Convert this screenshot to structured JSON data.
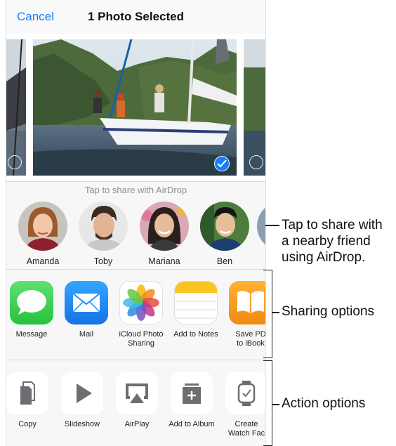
{
  "navbar": {
    "cancel_label": "Cancel",
    "title": "1 Photo Selected"
  },
  "photos": [
    {
      "name": "partial-left-photo",
      "selected": false
    },
    {
      "name": "sailboat-photo",
      "selected": true
    },
    {
      "name": "partial-right-photo",
      "selected": false
    }
  ],
  "airdrop": {
    "hint": "Tap to share with AirDrop",
    "contacts": [
      {
        "name": "Amanda"
      },
      {
        "name": "Toby"
      },
      {
        "name": "Mariana"
      },
      {
        "name": "Ben"
      }
    ]
  },
  "share_apps": [
    {
      "label": "Message",
      "icon": "message-icon"
    },
    {
      "label": "Mail",
      "icon": "mail-icon"
    },
    {
      "label_line1": "iCloud Photo",
      "label_line2": "Sharing",
      "icon": "photos-icon"
    },
    {
      "label": "Add to Notes",
      "icon": "notes-icon"
    },
    {
      "label_line1": "Save PD",
      "label_line2": "to iBook",
      "icon": "ibooks-icon"
    }
  ],
  "actions": [
    {
      "label": "Copy",
      "icon": "copy-icon"
    },
    {
      "label": "Slideshow",
      "icon": "play-icon"
    },
    {
      "label": "AirPlay",
      "icon": "airplay-icon"
    },
    {
      "label": "Add to Album",
      "icon": "add-album-icon"
    },
    {
      "label_line1": "Create",
      "label_line2": "Watch Fac",
      "icon": "watch-icon"
    }
  ],
  "callouts": {
    "airdrop_line1": "Tap to share with",
    "airdrop_line2": "a nearby friend",
    "airdrop_line3": "using AirDrop.",
    "sharing": "Sharing options",
    "action": "Action options"
  },
  "colors": {
    "accent": "#157efb",
    "message_green": "#3fd45c",
    "mail_blue": "#1e8df2",
    "ibooks_orange": "#f59a20"
  }
}
